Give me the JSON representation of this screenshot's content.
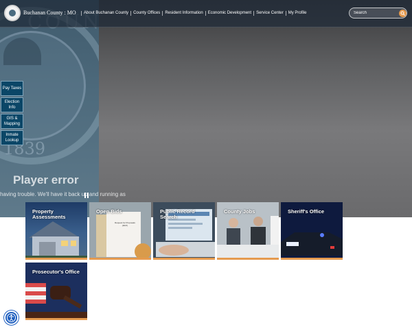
{
  "brand": {
    "name": "Buchanan County",
    "state": "MO",
    "logo_icon": "county-seal-icon"
  },
  "nav": {
    "items": [
      "About Buchanan County",
      "County Offices",
      "Resident Information",
      "Economic Development",
      "Service Center",
      "My Profile"
    ]
  },
  "search": {
    "placeholder": "Search",
    "icon": "search-icon",
    "accent": "#e59a4e"
  },
  "quick_links": [
    "Pay Taxes",
    "Election Info",
    "GIS & Mapping",
    "Inmate Lookup"
  ],
  "hero": {
    "seal_year": "1839",
    "seal_text": "COUN",
    "player_error_title": "Player error",
    "player_error_message": "having trouble. We'll have it back up and running as"
  },
  "tiles": [
    {
      "label": "Property Assessments"
    },
    {
      "label": "Open Bids",
      "image_text": "Request for Proposals (RFP)"
    },
    {
      "label": "Public Record Search"
    },
    {
      "label": "County Jobs"
    },
    {
      "label": "Sheriff's Office"
    },
    {
      "label": "Prosecutor's Office"
    }
  ],
  "accessibility": {
    "icon": "accessibility-icon"
  },
  "colors": {
    "header_bg": "#1e2a37",
    "quick_link_bg": "#0b4667",
    "tile_accent": "#e59a4e",
    "a11y": "#1f5fbf"
  }
}
